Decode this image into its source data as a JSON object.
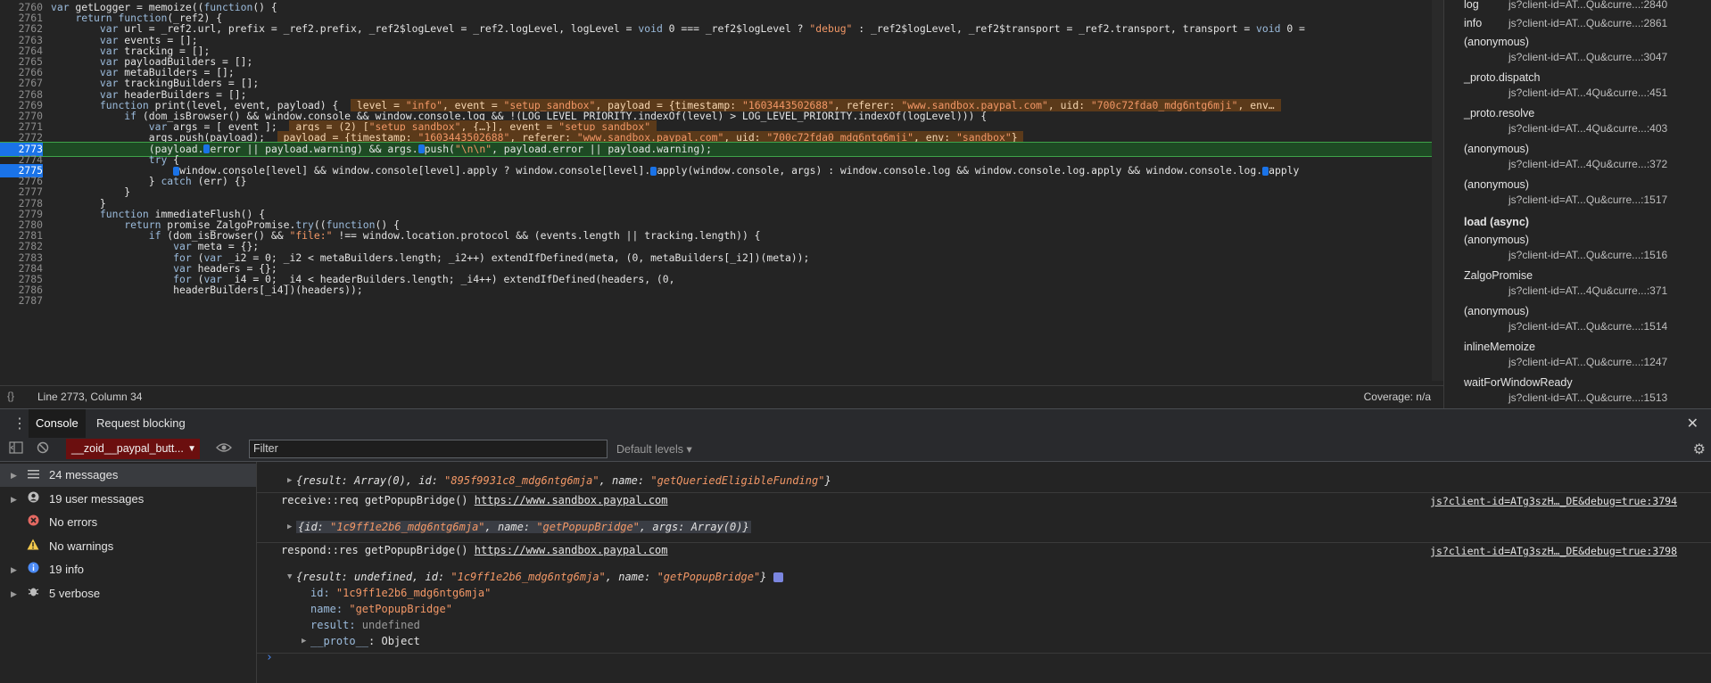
{
  "editor": {
    "lines": [
      {
        "n": "2760",
        "code": "var getLogger = memoize((function() {"
      },
      {
        "n": "2761",
        "code": "    return function(_ref2) {"
      },
      {
        "n": "2762",
        "code": "        var url = _ref2.url, prefix = _ref2.prefix, _ref2$logLevel = _ref2.logLevel, logLevel = void 0 === _ref2$logLevel ? \"debug\" : _ref2$logLevel, _ref2$transport = _ref2.transport, transport = void 0 ="
      },
      {
        "n": "2763",
        "code": "        var events = [];"
      },
      {
        "n": "2764",
        "code": "        var tracking = [];"
      },
      {
        "n": "2765",
        "code": "        var payloadBuilders = [];"
      },
      {
        "n": "2766",
        "code": "        var metaBuilders = [];"
      },
      {
        "n": "2767",
        "code": "        var trackingBuilders = [];"
      },
      {
        "n": "2768",
        "code": "        var headerBuilders = [];"
      },
      {
        "n": "2769",
        "code": "        function print(level, event, payload) {",
        "inline": "level = \"info\", event = \"setup_sandbox\", payload = {timestamp: \"1603443502688\", referer: \"www.sandbox.paypal.com\", uid: \"700c72fda0_mdg6ntg6mji\", env…"
      },
      {
        "n": "2770",
        "code": "            if (dom_isBrowser() && window.console && window.console.log && !(LOG_LEVEL_PRIORITY.indexOf(level) > LOG_LEVEL_PRIORITY.indexOf(logLevel))) {"
      },
      {
        "n": "2771",
        "code": "                var args = [ event ];",
        "inline": "args = (2) [\"setup_sandbox\", {…}], event = \"setup_sandbox\""
      },
      {
        "n": "2772",
        "code": "                args.push(payload);",
        "inline": "payload = {timestamp: \"1603443502688\", referer: \"www.sandbox.paypal.com\", uid: \"700c72fda0_mdg6ntg6mji\", env: \"sandbox\"}"
      },
      {
        "n": "2773",
        "code": "                (payload.▮error || payload.warning) && args.▮push(\"\\n\\n\", payload.error || payload.warning);"
      },
      {
        "n": "2774",
        "code": "                try {"
      },
      {
        "n": "2775",
        "code": "                    ▮window.console[level] && window.console[level].apply ? window.console[level].▮apply(window.console, args) : window.console.log && window.console.log.apply && window.console.log.▮apply"
      },
      {
        "n": "2776",
        "code": "                } catch (err) {}"
      },
      {
        "n": "2777",
        "code": "            }"
      },
      {
        "n": "2778",
        "code": "        }"
      },
      {
        "n": "2779",
        "code": "        function immediateFlush() {"
      },
      {
        "n": "2780",
        "code": "            return promise_ZalgoPromise.try((function() {"
      },
      {
        "n": "2781",
        "code": "                if (dom_isBrowser() && \"file:\" !== window.location.protocol && (events.length || tracking.length)) {"
      },
      {
        "n": "2782",
        "code": "                    var meta = {};"
      },
      {
        "n": "2783",
        "code": "                    for (var _i2 = 0; _i2 < metaBuilders.length; _i2++) extendIfDefined(meta, (0, metaBuilders[_i2])(meta));"
      },
      {
        "n": "2784",
        "code": "                    var headers = {};"
      },
      {
        "n": "2785",
        "code": "                    for (var _i4 = 0; _i4 < headerBuilders.length; _i4++) extendIfDefined(headers, (0,"
      },
      {
        "n": "2786",
        "code": "                    headerBuilders[_i4])(headers));"
      },
      {
        "n": "2787",
        "code": ""
      }
    ]
  },
  "status": {
    "braces": "{}",
    "position": "Line 2773, Column 34",
    "coverage": "Coverage: n/a"
  },
  "callstack": [
    {
      "name": "log",
      "file": "js?client-id=AT...Qu&curre...:2840",
      "inline": true
    },
    {
      "name": "info",
      "file": "js?client-id=AT...Qu&curre...:2861",
      "inline": true
    },
    {
      "name": "(anonymous)",
      "file": "js?client-id=AT...Qu&curre...:3047"
    },
    {
      "name": "_proto.dispatch",
      "file": "js?client-id=AT...4Qu&curre...:451"
    },
    {
      "name": "_proto.resolve",
      "file": "js?client-id=AT...4Qu&curre...:403"
    },
    {
      "name": "(anonymous)",
      "file": "js?client-id=AT...4Qu&curre...:372"
    },
    {
      "name": "(anonymous)",
      "file": "js?client-id=AT...Qu&curre...:1517"
    },
    {
      "name": "load (async)",
      "file": "",
      "async": true
    },
    {
      "name": "(anonymous)",
      "file": "js?client-id=AT...Qu&curre...:1516"
    },
    {
      "name": "ZalgoPromise",
      "file": "js?client-id=AT...4Qu&curre...:371"
    },
    {
      "name": "(anonymous)",
      "file": "js?client-id=AT...Qu&curre...:1514"
    },
    {
      "name": "inlineMemoize",
      "file": "js?client-id=AT...Qu&curre...:1247"
    },
    {
      "name": "waitForWindowReady",
      "file": "js?client-id=AT...Qu&curre...:1513"
    }
  ],
  "drawer": {
    "dots": "⋮",
    "tabs": [
      "Console",
      "Request blocking"
    ],
    "close": "✕"
  },
  "toolbar": {
    "context": "__zoid__paypal_butt...",
    "filter_placeholder": "Filter",
    "levels": "Default levels ▾"
  },
  "sidebar": [
    {
      "label": "24 messages",
      "icon": "list-icon",
      "selected": true
    },
    {
      "label": "19 user messages",
      "icon": "user-icon"
    },
    {
      "label": "No errors",
      "icon": "error-icon"
    },
    {
      "label": "No warnings",
      "icon": "warning-icon"
    },
    {
      "label": "19 info",
      "icon": "info-icon"
    },
    {
      "label": "5 verbose",
      "icon": "bug-icon"
    }
  ],
  "messages": {
    "m1": {
      "prefix": "{result: Array(0), id: ",
      "id": "\"895f9931c8_mdg6ntg6mja\"",
      "mid": ", name: ",
      "name": "\"getQueriedEligibleFunding\"",
      "end": "}"
    },
    "m2": {
      "text": "receive::req getPopupBridge() ",
      "link": "https://www.sandbox.paypal.com",
      "src": "js?client-id=ATg3szH…_DE&debug=true:3794"
    },
    "m3": {
      "prefix": "{id: ",
      "id": "\"1c9ff1e2b6_mdg6ntg6mja\"",
      "mid": ", name: ",
      "name": "\"getPopupBridge\"",
      "end": ", args: Array(0)}"
    },
    "m4": {
      "text": "respond::res getPopupBridge() ",
      "link": "https://www.sandbox.paypal.com",
      "src": "js?client-id=ATg3szH…_DE&debug=true:3798"
    },
    "m5": {
      "prefix": "{result: undefined, id: ",
      "id": "\"1c9ff1e2b6_mdg6ntg6mja\"",
      "mid": ", name: ",
      "name": "\"getPopupBridge\"",
      "end": "}"
    },
    "m5_id": {
      "k": "id: ",
      "v": "\"1c9ff1e2b6_mdg6ntg6mja\""
    },
    "m5_name": {
      "k": "name: ",
      "v": "\"getPopupBridge\""
    },
    "m5_result": {
      "k": "result: ",
      "v": "undefined"
    },
    "m5_proto": {
      "k": "__proto__",
      "v": ": Object"
    },
    "prompt": "›"
  }
}
